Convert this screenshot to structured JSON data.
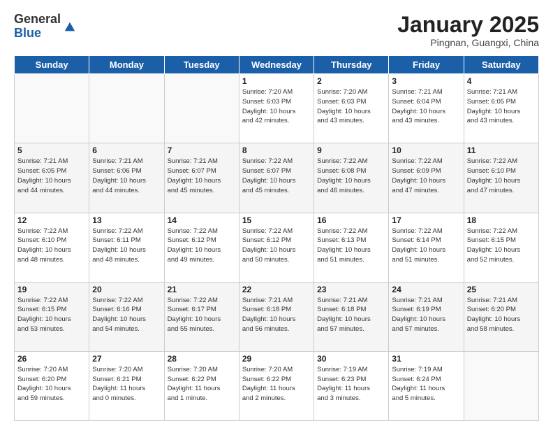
{
  "header": {
    "logo_general": "General",
    "logo_blue": "Blue",
    "month_title": "January 2025",
    "subtitle": "Pingnan, Guangxi, China"
  },
  "days_of_week": [
    "Sunday",
    "Monday",
    "Tuesday",
    "Wednesday",
    "Thursday",
    "Friday",
    "Saturday"
  ],
  "weeks": [
    [
      {
        "num": "",
        "info": ""
      },
      {
        "num": "",
        "info": ""
      },
      {
        "num": "",
        "info": ""
      },
      {
        "num": "1",
        "info": "Sunrise: 7:20 AM\nSunset: 6:03 PM\nDaylight: 10 hours\nand 42 minutes."
      },
      {
        "num": "2",
        "info": "Sunrise: 7:20 AM\nSunset: 6:03 PM\nDaylight: 10 hours\nand 43 minutes."
      },
      {
        "num": "3",
        "info": "Sunrise: 7:21 AM\nSunset: 6:04 PM\nDaylight: 10 hours\nand 43 minutes."
      },
      {
        "num": "4",
        "info": "Sunrise: 7:21 AM\nSunset: 6:05 PM\nDaylight: 10 hours\nand 43 minutes."
      }
    ],
    [
      {
        "num": "5",
        "info": "Sunrise: 7:21 AM\nSunset: 6:05 PM\nDaylight: 10 hours\nand 44 minutes."
      },
      {
        "num": "6",
        "info": "Sunrise: 7:21 AM\nSunset: 6:06 PM\nDaylight: 10 hours\nand 44 minutes."
      },
      {
        "num": "7",
        "info": "Sunrise: 7:21 AM\nSunset: 6:07 PM\nDaylight: 10 hours\nand 45 minutes."
      },
      {
        "num": "8",
        "info": "Sunrise: 7:22 AM\nSunset: 6:07 PM\nDaylight: 10 hours\nand 45 minutes."
      },
      {
        "num": "9",
        "info": "Sunrise: 7:22 AM\nSunset: 6:08 PM\nDaylight: 10 hours\nand 46 minutes."
      },
      {
        "num": "10",
        "info": "Sunrise: 7:22 AM\nSunset: 6:09 PM\nDaylight: 10 hours\nand 47 minutes."
      },
      {
        "num": "11",
        "info": "Sunrise: 7:22 AM\nSunset: 6:10 PM\nDaylight: 10 hours\nand 47 minutes."
      }
    ],
    [
      {
        "num": "12",
        "info": "Sunrise: 7:22 AM\nSunset: 6:10 PM\nDaylight: 10 hours\nand 48 minutes."
      },
      {
        "num": "13",
        "info": "Sunrise: 7:22 AM\nSunset: 6:11 PM\nDaylight: 10 hours\nand 48 minutes."
      },
      {
        "num": "14",
        "info": "Sunrise: 7:22 AM\nSunset: 6:12 PM\nDaylight: 10 hours\nand 49 minutes."
      },
      {
        "num": "15",
        "info": "Sunrise: 7:22 AM\nSunset: 6:12 PM\nDaylight: 10 hours\nand 50 minutes."
      },
      {
        "num": "16",
        "info": "Sunrise: 7:22 AM\nSunset: 6:13 PM\nDaylight: 10 hours\nand 51 minutes."
      },
      {
        "num": "17",
        "info": "Sunrise: 7:22 AM\nSunset: 6:14 PM\nDaylight: 10 hours\nand 51 minutes."
      },
      {
        "num": "18",
        "info": "Sunrise: 7:22 AM\nSunset: 6:15 PM\nDaylight: 10 hours\nand 52 minutes."
      }
    ],
    [
      {
        "num": "19",
        "info": "Sunrise: 7:22 AM\nSunset: 6:15 PM\nDaylight: 10 hours\nand 53 minutes."
      },
      {
        "num": "20",
        "info": "Sunrise: 7:22 AM\nSunset: 6:16 PM\nDaylight: 10 hours\nand 54 minutes."
      },
      {
        "num": "21",
        "info": "Sunrise: 7:22 AM\nSunset: 6:17 PM\nDaylight: 10 hours\nand 55 minutes."
      },
      {
        "num": "22",
        "info": "Sunrise: 7:21 AM\nSunset: 6:18 PM\nDaylight: 10 hours\nand 56 minutes."
      },
      {
        "num": "23",
        "info": "Sunrise: 7:21 AM\nSunset: 6:18 PM\nDaylight: 10 hours\nand 57 minutes."
      },
      {
        "num": "24",
        "info": "Sunrise: 7:21 AM\nSunset: 6:19 PM\nDaylight: 10 hours\nand 57 minutes."
      },
      {
        "num": "25",
        "info": "Sunrise: 7:21 AM\nSunset: 6:20 PM\nDaylight: 10 hours\nand 58 minutes."
      }
    ],
    [
      {
        "num": "26",
        "info": "Sunrise: 7:20 AM\nSunset: 6:20 PM\nDaylight: 10 hours\nand 59 minutes."
      },
      {
        "num": "27",
        "info": "Sunrise: 7:20 AM\nSunset: 6:21 PM\nDaylight: 11 hours\nand 0 minutes."
      },
      {
        "num": "28",
        "info": "Sunrise: 7:20 AM\nSunset: 6:22 PM\nDaylight: 11 hours\nand 1 minute."
      },
      {
        "num": "29",
        "info": "Sunrise: 7:20 AM\nSunset: 6:22 PM\nDaylight: 11 hours\nand 2 minutes."
      },
      {
        "num": "30",
        "info": "Sunrise: 7:19 AM\nSunset: 6:23 PM\nDaylight: 11 hours\nand 3 minutes."
      },
      {
        "num": "31",
        "info": "Sunrise: 7:19 AM\nSunset: 6:24 PM\nDaylight: 11 hours\nand 5 minutes."
      },
      {
        "num": "",
        "info": ""
      }
    ]
  ]
}
